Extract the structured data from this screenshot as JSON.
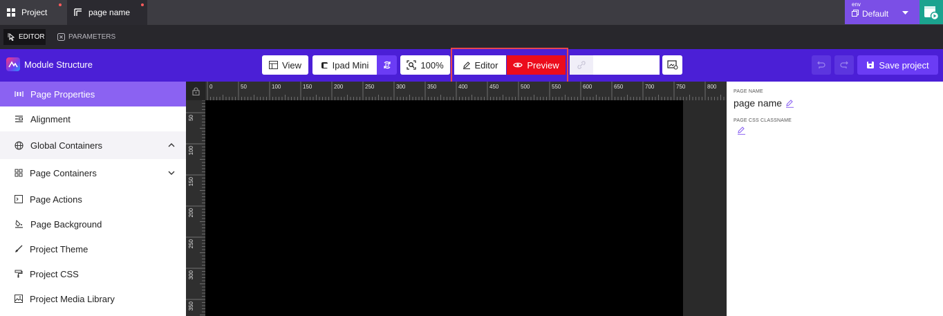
{
  "tabs": [
    {
      "label": "Project",
      "icon": "grid-icon",
      "unsaved": true
    },
    {
      "label": "page name",
      "icon": "page-layout-icon",
      "unsaved": true,
      "active": true
    }
  ],
  "env": {
    "label": "env",
    "value": "Default"
  },
  "modes": [
    {
      "label": "EDITOR",
      "active": true
    },
    {
      "label": "PARAMETERS",
      "active": false
    }
  ],
  "toolbar": {
    "title": "Module Structure",
    "view_label": "View",
    "device_label": "Ipad Mini",
    "zoom_label": "100%",
    "editor_label": "Editor",
    "preview_label": "Preview",
    "search_value": "",
    "save_label": "Save project"
  },
  "sidebar": {
    "items": [
      {
        "label": "Page Properties",
        "icon": "page-properties-icon",
        "active": true
      },
      {
        "label": "Alignment",
        "icon": "alignment-icon"
      },
      {
        "label": "Global Containers",
        "icon": "globe-icon",
        "expanded": true
      },
      {
        "label": "Page Containers",
        "icon": "containers-icon",
        "expanded": false
      },
      {
        "label": "Page Actions",
        "icon": "terminal-icon"
      },
      {
        "label": "Page Background",
        "icon": "paint-bucket-icon"
      },
      {
        "label": "Project Theme",
        "icon": "theme-brush-icon"
      },
      {
        "label": "Project CSS",
        "icon": "paint-roller-icon"
      },
      {
        "label": "Project Media Library",
        "icon": "image-icon"
      }
    ]
  },
  "ruler": {
    "horizontal": [
      "0",
      "50",
      "100",
      "150",
      "200",
      "250",
      "300",
      "350",
      "400",
      "450",
      "500",
      "550",
      "600",
      "650",
      "700",
      "750",
      "800"
    ],
    "vertical": [
      "50",
      "100",
      "150",
      "200",
      "250",
      "300",
      "350"
    ]
  },
  "properties": {
    "page_name_label": "PAGE NAME",
    "page_name_value": "page name",
    "css_label": "PAGE CSS CLASSNAME",
    "css_value": ""
  },
  "colors": {
    "toolbar": "#4b1fd6",
    "accent": "#8b62f2",
    "preview": "#ec0c1c",
    "env": "#7b4fe6",
    "env_button": "#1ba38f"
  }
}
